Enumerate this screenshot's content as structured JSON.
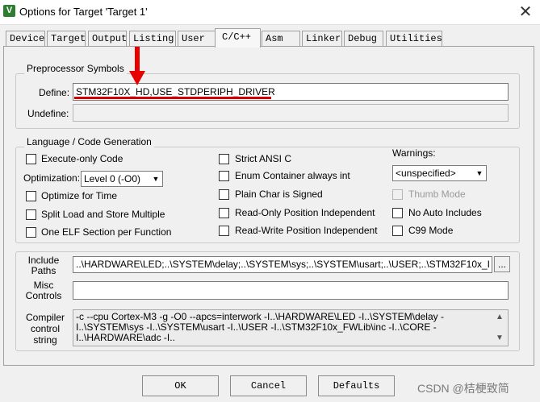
{
  "window": {
    "title": "Options for Target 'Target 1'",
    "icon": "uvision-v-icon",
    "close": "✕"
  },
  "tabs": [
    {
      "label": "Device"
    },
    {
      "label": "Target"
    },
    {
      "label": "Output"
    },
    {
      "label": "Listing"
    },
    {
      "label": "User"
    },
    {
      "label": "C/C++",
      "active": true
    },
    {
      "label": "Asm"
    },
    {
      "label": "Linker"
    },
    {
      "label": "Debug"
    },
    {
      "label": "Utilities"
    }
  ],
  "preprocessor": {
    "group_label": "Preprocessor Symbols",
    "define_label": "Define:",
    "define_value": "STM32F10X_HD,USE_STDPERIPH_DRIVER",
    "undefine_label": "Undefine:",
    "undefine_value": ""
  },
  "language": {
    "group_label": "Language / Code Generation",
    "execute_only": {
      "label": "Execute-only Code",
      "checked": false
    },
    "optimization_label": "Optimization:",
    "optimization_value": "Level 0 (-O0)",
    "optimize_time": {
      "label": "Optimize for Time",
      "checked": false
    },
    "split_load": {
      "label": "Split Load and Store Multiple",
      "checked": false
    },
    "one_elf": {
      "label": "One ELF Section per Function",
      "checked": false
    },
    "strict_ansi": {
      "label": "Strict ANSI C",
      "checked": false
    },
    "enum_container": {
      "label": "Enum Container always int",
      "checked": false
    },
    "plain_char": {
      "label": "Plain Char is Signed",
      "checked": false
    },
    "readonly_pos": {
      "label": "Read-Only Position Independent",
      "checked": false
    },
    "readwrite_pos": {
      "label": "Read-Write Position Independent",
      "checked": false
    },
    "warnings_label": "Warnings:",
    "warnings_value": "<unspecified>",
    "thumb_mode": {
      "label": "Thumb Mode",
      "checked": false,
      "disabled": true
    },
    "no_auto_includes": {
      "label": "No Auto Includes",
      "checked": false
    },
    "c99_mode": {
      "label": "C99 Mode",
      "checked": false
    }
  },
  "paths": {
    "include_label": "Include\nPaths",
    "include_value": "..\\HARDWARE\\LED;..\\SYSTEM\\delay;..\\SYSTEM\\sys;..\\SYSTEM\\usart;..\\USER;..\\STM32F10x_I",
    "browse_label": "...",
    "misc_label": "Misc\nControls",
    "misc_value": "",
    "compiler_label": "Compiler\ncontrol\nstring",
    "compiler_value": "-c --cpu Cortex-M3 -g -O0 --apcs=interwork -I..\\HARDWARE\\LED -I..\\SYSTEM\\delay -I..\\SYSTEM\\sys -I..\\SYSTEM\\usart -I..\\USER -I..\\STM32F10x_FWLib\\inc -I..\\CORE -I..\\HARDWARE\\adc -I..",
    "scroll_up": "▲",
    "scroll_down": "▼"
  },
  "buttons": {
    "ok": "OK",
    "cancel": "Cancel",
    "defaults": "Defaults"
  },
  "watermark": "CSDN @桔梗致简",
  "colors": {
    "annotation_red": "#d40000",
    "arrow_red": "#e60000"
  }
}
